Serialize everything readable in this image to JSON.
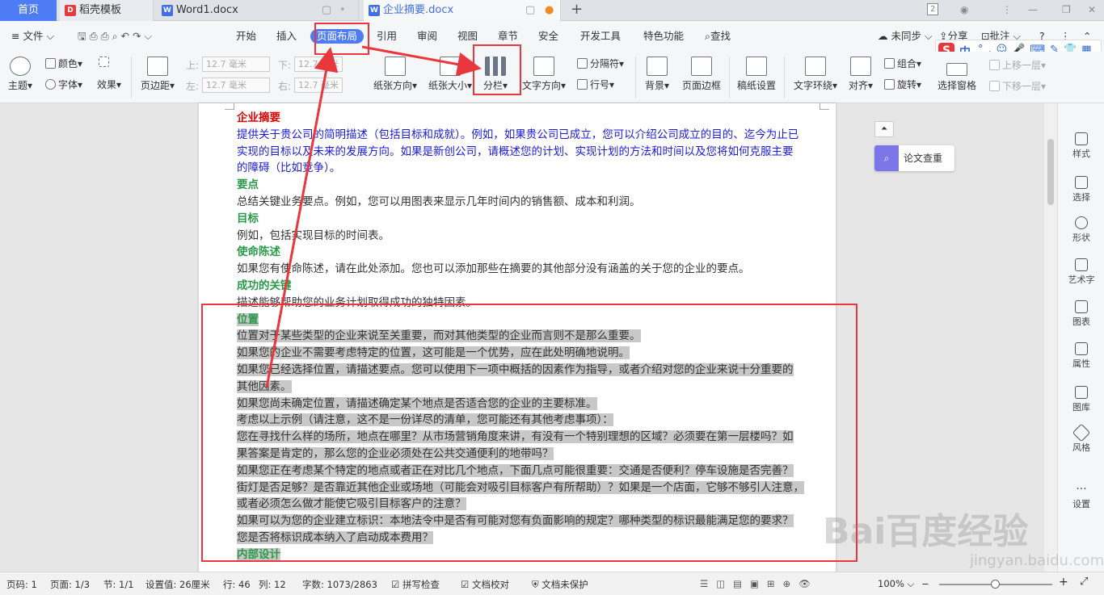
{
  "tabs": [
    {
      "label": "首页"
    },
    {
      "label": "稻壳模板"
    },
    {
      "label": "Word1.docx"
    },
    {
      "label": "企业摘要.docx"
    }
  ],
  "window": {
    "badge": "2"
  },
  "menus": [
    "文件",
    "开始",
    "插入",
    "页面布局",
    "引用",
    "审阅",
    "视图",
    "章节",
    "安全",
    "开发工具",
    "特色功能",
    "查找"
  ],
  "menu_right": {
    "sync": "未同步",
    "share": "分享",
    "comment": "批注"
  },
  "ribbon": {
    "theme": "主题",
    "color": "颜色",
    "font": "字体",
    "effect": "效果",
    "margin": "页边距",
    "top_label": "上:",
    "top_val": "12.7 毫米",
    "bottom_label": "下:",
    "bottom_val": "12.7 毫米",
    "left_label": "左:",
    "left_val": "12.7 毫米",
    "right_label": "右:",
    "right_val": "12.7 毫米",
    "orientation": "纸张方向",
    "size": "纸张大小",
    "columns": "分栏",
    "text_direction": "文字方向",
    "separator": "分隔符",
    "line_num": "行号",
    "background": "背景",
    "border": "页面边框",
    "grid_paper": "稿纸设置",
    "wrap": "文字环绕",
    "align": "对齐",
    "group": "组合",
    "rotate": "旋转",
    "selection": "选择窗格",
    "forward": "上移一层",
    "backward": "下移一层"
  },
  "ime": {
    "logo": "S",
    "mode": "中"
  },
  "document": {
    "lines": [
      {
        "cls": "h-red",
        "text": "企业摘要"
      },
      {
        "cls": "blue",
        "text": "提供关于贵公司的简明描述（包括目标和成就）。例如，如果贵公司已成立，您可以介绍公司成立的目的、迄今为止已"
      },
      {
        "cls": "blue",
        "text": "实现的目标以及未来的发展方向。如果是新创公司，请概述您的计划、实现计划的方法和时间以及您将如何克服主要"
      },
      {
        "cls": "blue",
        "text": "的障碍（比如竞争）。"
      },
      {
        "cls": "h",
        "text": "要点"
      },
      {
        "cls": "",
        "text": "总结关键业务要点。例如，您可以用图表来显示几年时间内的销售额、成本和利润。"
      },
      {
        "cls": "h",
        "text": "目标"
      },
      {
        "cls": "",
        "text": "例如，包括实现目标的时间表。"
      },
      {
        "cls": "h",
        "text": "使命陈述"
      },
      {
        "cls": "",
        "text": "如果您有使命陈述，请在此处添加。您也可以添加那些在摘要的其他部分没有涵盖的关于您的企业的要点。"
      },
      {
        "cls": "h",
        "text": "成功的关键"
      },
      {
        "cls": "",
        "text": "描述能够帮助您的业务计划取得成功的独特因素。"
      },
      {
        "cls": "h sel",
        "text": "位置"
      },
      {
        "cls": "sel",
        "text": "位置对于某些类型的企业来说至关重要，而对其他类型的企业而言则不是那么重要。"
      },
      {
        "cls": "sel",
        "text": "如果您的企业不需要考虑特定的位置，这可能是一个优势，应在此处明确地说明。"
      },
      {
        "cls": "sel",
        "text": "如果您已经选择位置，请描述要点。您可以使用下一项中概括的因素作为指导，或者介绍对您的企业来说十分重要的"
      },
      {
        "cls": "sel",
        "text": "其他因素。"
      },
      {
        "cls": "sel",
        "text": "如果您尚未确定位置，请描述确定某个地点是否适合您的企业的主要标准。"
      },
      {
        "cls": "sel",
        "text": "考虑以上示例（请注意，这不是一份详尽的清单，您可能还有其他考虑事项）："
      },
      {
        "cls": "sel",
        "text": "您在寻找什么样的场所，地点在哪里？从市场营销角度来讲，有没有一个特别理想的区域？必须要在第一层楼吗？如"
      },
      {
        "cls": "sel",
        "text": "果答案是肯定的，那么您的企业必须处在公共交通便利的地带吗？"
      },
      {
        "cls": "sel",
        "text": "如果您正在考虑某个特定的地点或者正在对比几个地点，下面几点可能很重要：交通是否便利？停车设施是否完善？"
      },
      {
        "cls": "sel",
        "text": "街灯是否足够？是否靠近其他企业或场地（可能会对吸引目标客户有所帮助）？如果是一个店面，它够不够引人注意，"
      },
      {
        "cls": "sel",
        "text": "或者必须怎么做才能使它吸引目标客户的注意？"
      },
      {
        "cls": "sel",
        "text": "如果可以为您的企业建立标识：本地法令中是否有可能对您有负面影响的规定？哪种类型的标识最能满足您的要求？"
      },
      {
        "cls": "sel",
        "text": "您是否将标识成本纳入了启动成本费用？"
      },
      {
        "cls": "h sel",
        "text": "内部设计"
      }
    ]
  },
  "right_panel": {
    "paper_check": "论文查重",
    "items": [
      "样式",
      "选择",
      "形状",
      "艺术字",
      "图表",
      "属性",
      "图库",
      "风格",
      "设置"
    ]
  },
  "status": {
    "page_num": "页码: 1",
    "pages": "页面: 1/3",
    "section": "节: 1/1",
    "setting": "设置值: 26厘米",
    "row": "行: 46",
    "col": "列: 12",
    "words": "字数: 1073/2863",
    "spell": "拼写检查",
    "proof": "文档校对",
    "protect": "文档未保护",
    "zoom": "100%"
  },
  "watermark": {
    "brand": "Bai百度经验",
    "url": "jingyan.baidu.com"
  },
  "annotation_color": "#e8383d"
}
